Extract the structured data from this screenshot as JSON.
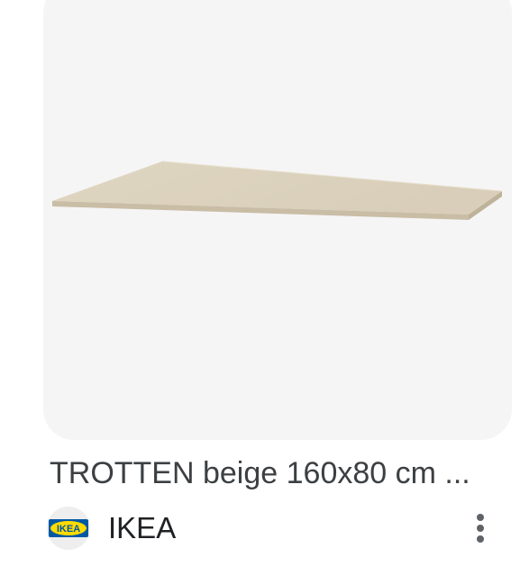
{
  "result": {
    "title": "TROTTEN beige 160x80 cm ...",
    "source": {
      "name": "IKEA",
      "favicon_text": "IKEA",
      "favicon_colors": {
        "blue": "#0058a3",
        "yellow": "#ffdb00"
      }
    },
    "menu_icon": "more-vert-icon",
    "image": {
      "subject": "beige tabletop",
      "background": "#f5f5f5",
      "top_color": "#ddd3bf",
      "edge_color": "#c9bda6"
    }
  }
}
